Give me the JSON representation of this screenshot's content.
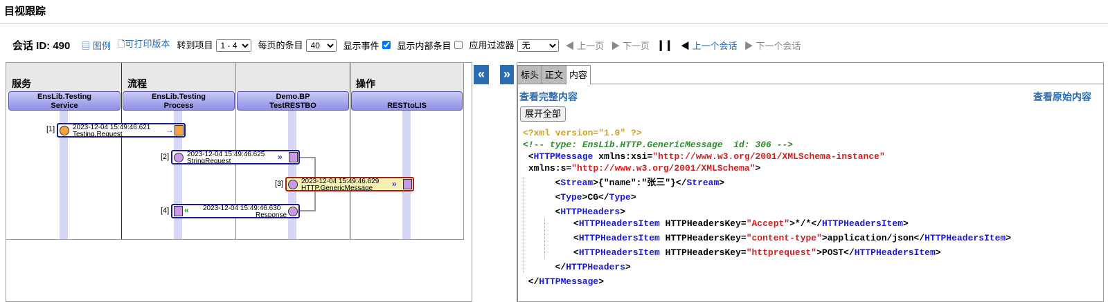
{
  "page_title": "目视跟踪",
  "toolbar": {
    "session_label": "会话 ID: 490",
    "legend_label": "图例",
    "printable_label": "可打印版本",
    "goto_label": "转到项目",
    "goto_value": "1 - 4",
    "per_page_label": "每页的条目",
    "per_page_value": "40",
    "show_events_label": "显示事件",
    "show_events_checked": true,
    "show_internal_label": "显示内部条目",
    "show_internal_checked": false,
    "apply_filter_label": "应用过滤器",
    "filter_value": "无",
    "prev_page": "上一页",
    "next_page": "下一页",
    "prev_session": "上一个会话",
    "next_session": "下一个会话"
  },
  "diagram": {
    "columns": [
      {
        "label": "服务"
      },
      {
        "label": "流程"
      },
      {
        "label": "操作"
      }
    ],
    "hosts": [
      {
        "line1": "EnsLib.Testing",
        "line2": "Service"
      },
      {
        "line1": "EnsLib.Testing",
        "line2": "Process"
      },
      {
        "line1": "Demo.BP",
        "line2": "TestRESTBO"
      },
      {
        "line1": "",
        "line2": "RESTtoLIS"
      }
    ],
    "messages": [
      {
        "num": "[1]",
        "time": "2023-12-04 15:49:46.621",
        "name": "Testing.Request"
      },
      {
        "num": "[2]",
        "time": "2023-12-04 15:49:46.625",
        "name": "StringRequest"
      },
      {
        "num": "[3]",
        "time": "2023-12-04 15:49:46.629",
        "name": "HTTP.GenericMessage"
      },
      {
        "num": "[4]",
        "time": "2023-12-04 15:49:46.630",
        "name": "Response"
      }
    ]
  },
  "panel": {
    "collapse_left": "«",
    "collapse_right": "»",
    "tabs": [
      {
        "label": "标头"
      },
      {
        "label": "正文"
      },
      {
        "label": "内容"
      }
    ],
    "view_full": "查看完整内容",
    "view_raw": "查看原始内容",
    "expand_all": "展开全部"
  },
  "xml": {
    "pi": "<?xml version=\"1.0\" ?>",
    "comment": "<!-- type: EnsLib.HTTP.GenericMessage  id: 306 -->",
    "root_tag": "HTTPMessage",
    "xmlns_xsi_name": "xmlns:xsi",
    "xmlns_xsi_value": "\"http://www.w3.org/2001/XMLSchema-instance\"",
    "xmlns_s_name": "xmlns:s",
    "xmlns_s_value": "\"http://www.w3.org/2001/XMLSchema\"",
    "stream_tag": "Stream",
    "stream_text": "{\"name\":\"张三\"}",
    "type_tag": "Type",
    "type_text": "CG",
    "headers_tag": "HTTPHeaders",
    "item_tag": "HTTPHeadersItem",
    "item_attr": "HTTPHeadersKey",
    "items": [
      {
        "key": "\"Accept\"",
        "value": "*/*"
      },
      {
        "key": "\"content-type\"",
        "value": "application/json"
      },
      {
        "key": "\"httprequest\"",
        "value": "POST"
      }
    ]
  },
  "colors": {
    "link": "#2a6db5",
    "host_box": "#8f8fe6",
    "selected_msg": "#f7eeb2",
    "service_circle": "#f5a33c",
    "process_circle": "#c99ae6"
  }
}
